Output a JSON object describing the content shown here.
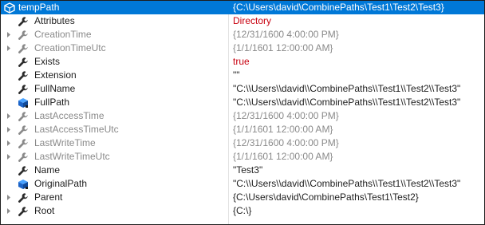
{
  "locals": {
    "root": {
      "name": "tempPath",
      "value": "{C:\\Users\\david\\CombinePaths\\Test1\\Test2\\Test3}",
      "icon": "object-icon",
      "expander": "expanded"
    },
    "children": [
      {
        "name": "Attributes",
        "value": "Directory",
        "icon": "wrench-icon",
        "dim": false,
        "value_color": "#c8000f",
        "expandable": false
      },
      {
        "name": "CreationTime",
        "value": "{12/31/1600 4:00:00 PM}",
        "icon": "wrench-icon",
        "dim": true,
        "value_color": "",
        "expandable": true
      },
      {
        "name": "CreationTimeUtc",
        "value": "{1/1/1601 12:00:00 AM}",
        "icon": "wrench-icon",
        "dim": true,
        "value_color": "",
        "expandable": true
      },
      {
        "name": "Exists",
        "value": "true",
        "icon": "wrench-icon",
        "dim": false,
        "value_color": "#c8000f",
        "expandable": false
      },
      {
        "name": "Extension",
        "value": "\"\"",
        "icon": "wrench-icon",
        "dim": false,
        "value_color": "",
        "expandable": false
      },
      {
        "name": "FullName",
        "value": "\"C:\\\\Users\\\\david\\\\CombinePaths\\\\Test1\\\\Test2\\\\Test3\"",
        "icon": "wrench-icon",
        "dim": false,
        "value_color": "",
        "expandable": false
      },
      {
        "name": "FullPath",
        "value": "\"C:\\\\Users\\\\david\\\\CombinePaths\\\\Test1\\\\Test2\\\\Test3\"",
        "icon": "field-icon",
        "dim": false,
        "value_color": "",
        "expandable": false
      },
      {
        "name": "LastAccessTime",
        "value": "{12/31/1600 4:00:00 PM}",
        "icon": "wrench-icon",
        "dim": true,
        "value_color": "",
        "expandable": true
      },
      {
        "name": "LastAccessTimeUtc",
        "value": "{1/1/1601 12:00:00 AM}",
        "icon": "wrench-icon",
        "dim": true,
        "value_color": "",
        "expandable": true
      },
      {
        "name": "LastWriteTime",
        "value": "{12/31/1600 4:00:00 PM}",
        "icon": "wrench-icon",
        "dim": true,
        "value_color": "",
        "expandable": true
      },
      {
        "name": "LastWriteTimeUtc",
        "value": "{1/1/1601 12:00:00 AM}",
        "icon": "wrench-icon",
        "dim": true,
        "value_color": "",
        "expandable": true
      },
      {
        "name": "Name",
        "value": "\"Test3\"",
        "icon": "wrench-icon",
        "dim": false,
        "value_color": "",
        "expandable": false
      },
      {
        "name": "OriginalPath",
        "value": "\"C:\\\\Users\\\\david\\\\CombinePaths\\\\Test1\\\\Test2\\\\Test3\"",
        "icon": "field-icon",
        "dim": false,
        "value_color": "",
        "expandable": false
      },
      {
        "name": "Parent",
        "value": "{C:\\Users\\david\\CombinePaths\\Test1\\Test2}",
        "icon": "wrench-icon",
        "dim": false,
        "value_color": "",
        "expandable": true
      },
      {
        "name": "Root",
        "value": "{C:\\}",
        "icon": "wrench-icon",
        "dim": false,
        "value_color": "",
        "expandable": true
      }
    ]
  },
  "colors": {
    "selection": "#0078d7",
    "value_red": "#c8000f",
    "dim_text": "#8a8a8a",
    "text": "#1e1e1e",
    "field_icon_blue": "#1c64c8"
  }
}
